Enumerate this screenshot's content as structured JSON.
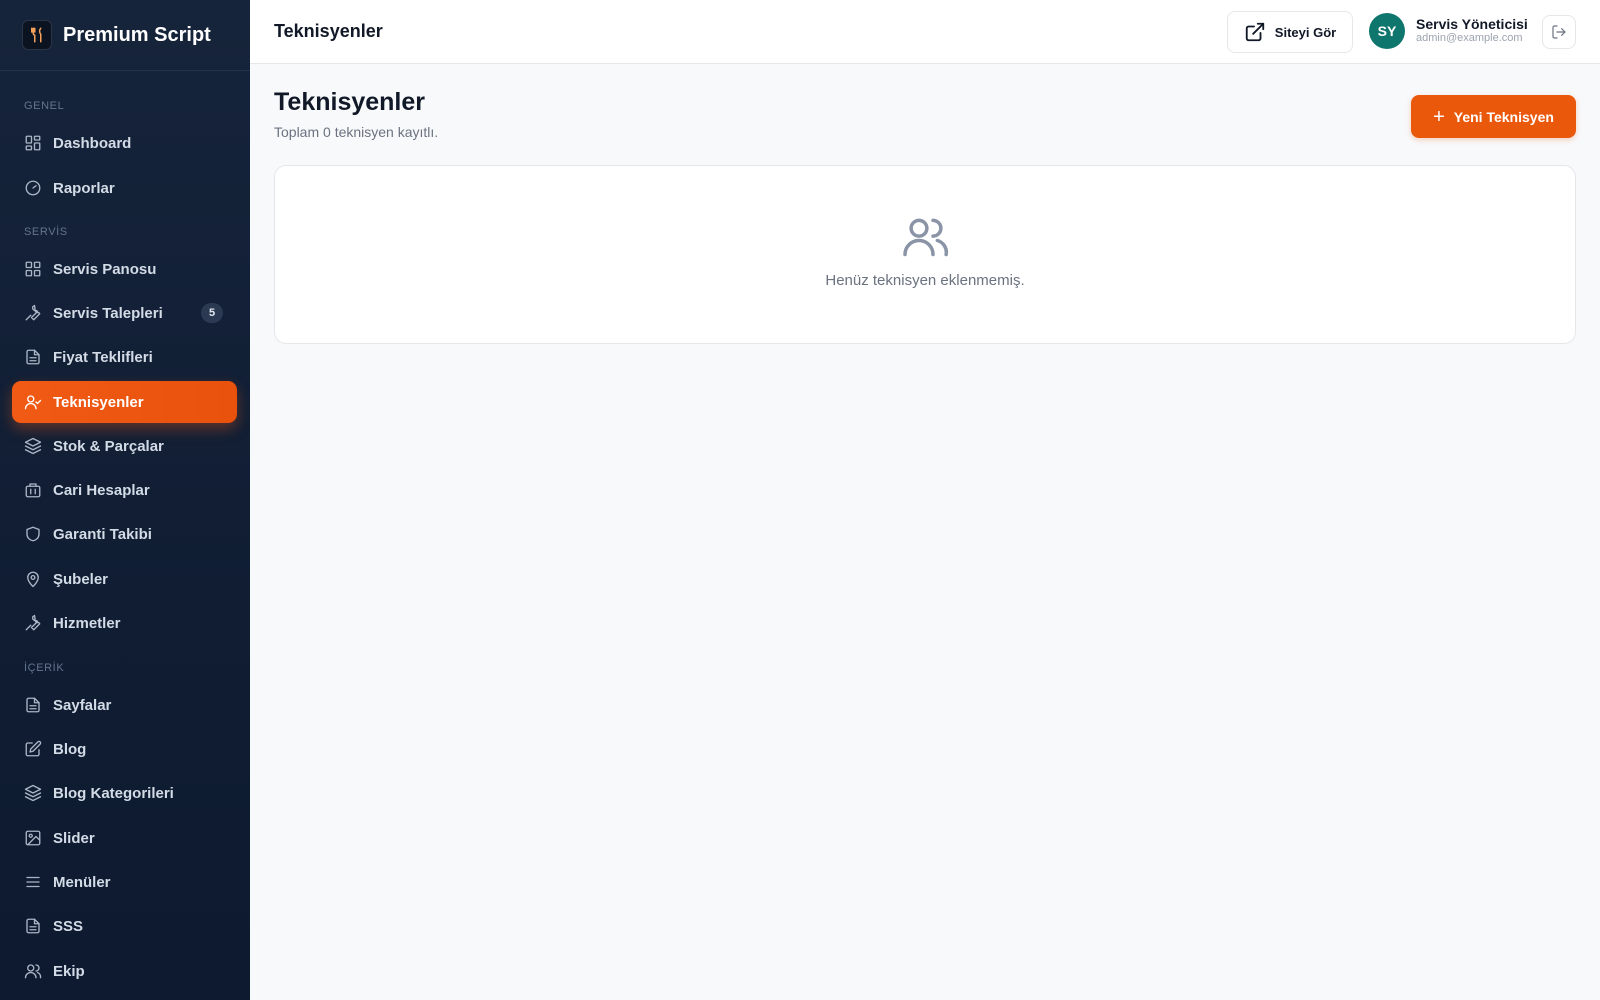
{
  "brand": {
    "name": "Premium Script"
  },
  "sidebar": {
    "sections": [
      {
        "label": "GENEL"
      },
      {
        "label": "SERVİS"
      },
      {
        "label": "İÇERİK"
      }
    ],
    "items": [
      {
        "label": "Dashboard",
        "icon": "dashboard-icon"
      },
      {
        "label": "Raporlar",
        "icon": "gauge-icon"
      },
      {
        "label": "Servis Panosu",
        "icon": "grid-icon"
      },
      {
        "label": "Servis Talepleri",
        "icon": "wrench-icon",
        "badge": "5"
      },
      {
        "label": "Fiyat Teklifleri",
        "icon": "document-icon"
      },
      {
        "label": "Teknisyenler",
        "icon": "user-check-icon",
        "active": true
      },
      {
        "label": "Stok & Parçalar",
        "icon": "layers-icon"
      },
      {
        "label": "Cari Hesaplar",
        "icon": "briefcase-icon"
      },
      {
        "label": "Garanti Takibi",
        "icon": "shield-icon"
      },
      {
        "label": "Şubeler",
        "icon": "map-pin-icon"
      },
      {
        "label": "Hizmetler",
        "icon": "wrench-icon"
      },
      {
        "label": "Sayfalar",
        "icon": "document-icon"
      },
      {
        "label": "Blog",
        "icon": "edit-icon"
      },
      {
        "label": "Blog Kategorileri",
        "icon": "layers-icon"
      },
      {
        "label": "Slider",
        "icon": "image-icon"
      },
      {
        "label": "Menüler",
        "icon": "menu-icon"
      },
      {
        "label": "SSS",
        "icon": "document-icon"
      },
      {
        "label": "Ekip",
        "icon": "users-icon"
      }
    ]
  },
  "header": {
    "title": "Teknisyenler",
    "view_site_label": "Siteyi Gör",
    "user": {
      "initials": "SY",
      "name": "Servis Yöneticisi",
      "email": "admin@example.com"
    }
  },
  "main": {
    "heading": "Teknisyenler",
    "subtitle": "Toplam 0 teknisyen kayıtlı.",
    "new_button_label": "Yeni Teknisyen",
    "new_button_icon": "+",
    "empty_state": {
      "icon": "users-icon",
      "text": "Henüz teknisyen eklenmemiş."
    }
  },
  "colors": {
    "accent": "#ea580c",
    "sidebar_bg": "#101d33",
    "avatar_bg": "#0f766e"
  }
}
